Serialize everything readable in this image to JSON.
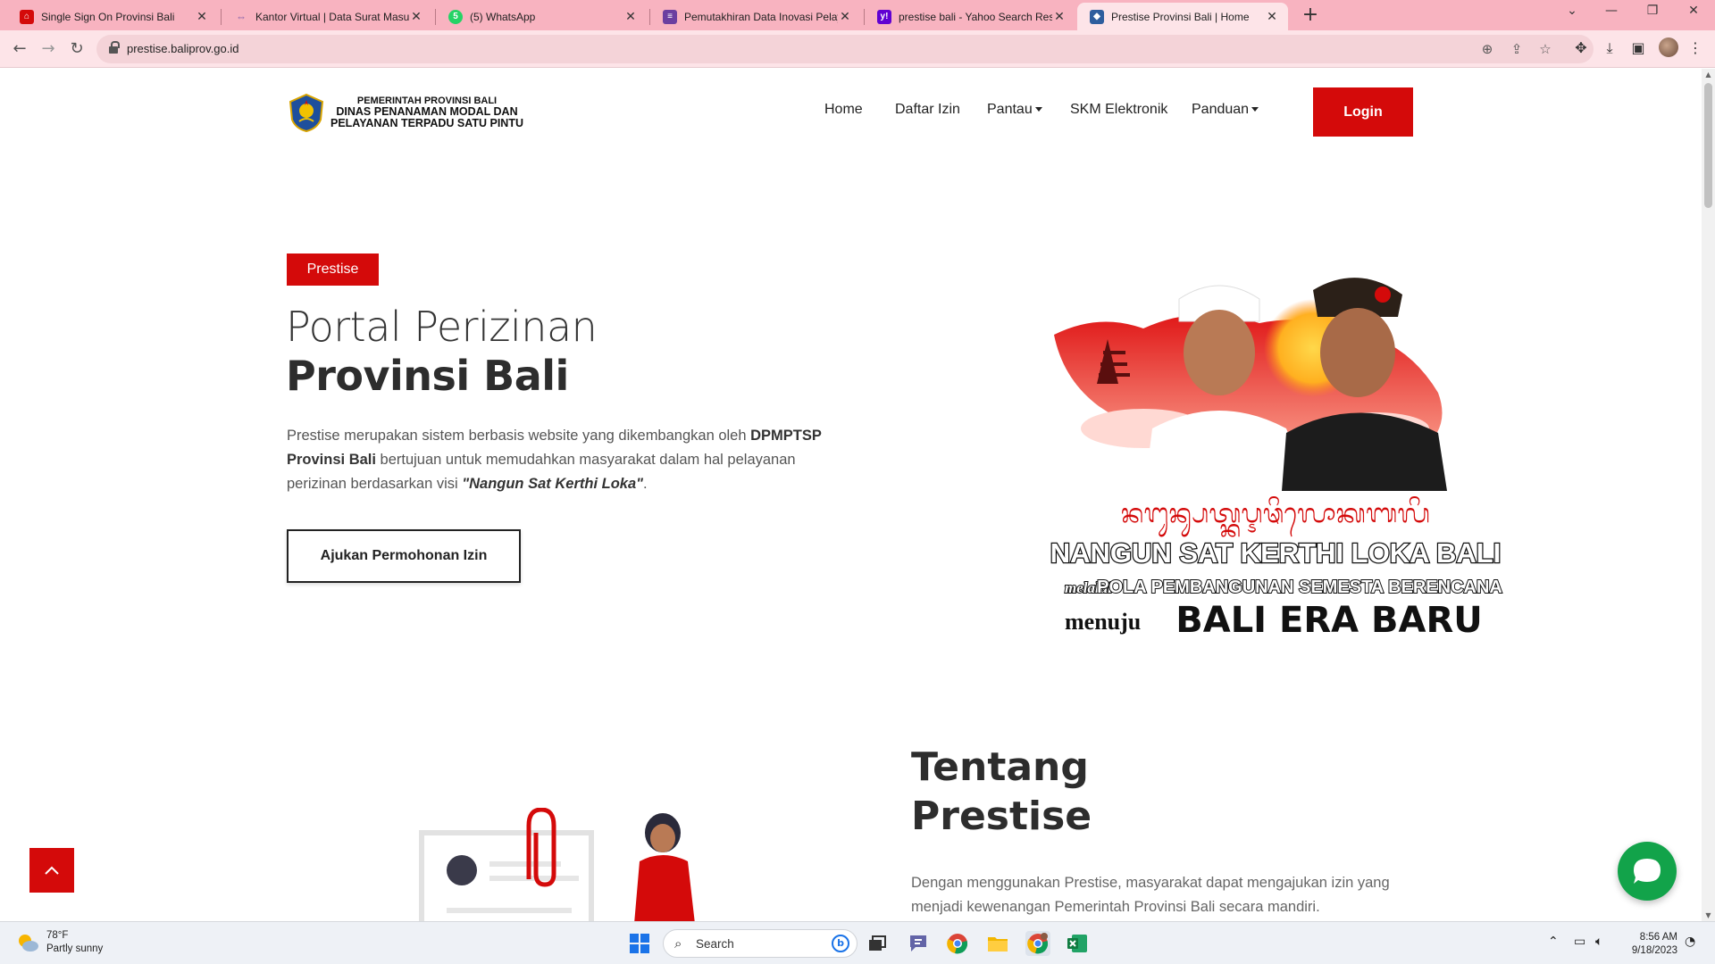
{
  "browser": {
    "tabs": [
      {
        "title": "Single Sign On Provinsi Bali",
        "active": false
      },
      {
        "title": "Kantor Virtual | Data Surat Masuk",
        "active": false
      },
      {
        "title": "(5) WhatsApp",
        "active": false
      },
      {
        "title": "Pemutakhiran Data Inovasi Pelaya",
        "active": false
      },
      {
        "title": "prestise bali - Yahoo Search Resu",
        "active": false
      },
      {
        "title": "Prestise Provinsi Bali | Home",
        "active": true
      }
    ],
    "url": "prestise.baliprov.go.id",
    "accent": "#f8b3c0"
  },
  "site": {
    "logo": {
      "line1": "PEMERINTAH PROVINSI BALI",
      "line2": "DINAS PENANAMAN MODAL DAN",
      "line3": "PELAYANAN TERPADU SATU PINTU"
    },
    "nav": {
      "home": "Home",
      "daftar_izin": "Daftar Izin",
      "pantau": "Pantau",
      "skm": "SKM Elektronik",
      "panduan": "Panduan",
      "login": "Login"
    },
    "brand_color": "#d40a0a"
  },
  "hero": {
    "badge": "Prestise",
    "title_line1": "Portal Perizinan",
    "title_line2": "Provinsi Bali",
    "desc_part1": "Prestise merupakan sistem berbasis website yang dikembangkan oleh ",
    "desc_bold": "DPMPTSP Provinsi Bali",
    "desc_part2": " bertujuan untuk memudahkan masyarakat dalam hal pelayanan perizinan berdasarkan visi ",
    "desc_em": "\"Nangun Sat Kerthi Loka\"",
    "desc_end": ".",
    "cta": "Ajukan Permohonan Izin"
  },
  "banner": {
    "script_text": "ᬦᬗᬸᬦ᭄ᬲᬢ᭄ᬓᬋᬣᬶᬮᭀᬓᬩᬮᬶ",
    "line1": "NANGUN SAT KERTHI LOKA BALI",
    "line2_prefix": "melalui",
    "line2": "POLA PEMBANGUNAN SEMESTA BERENCANA",
    "line3_prefix": "menuju",
    "line3": "BALI ERA BARU"
  },
  "about": {
    "title_line1": "Tentang",
    "title_line2": "Prestise",
    "desc": "Dengan menggunakan Prestise, masyarakat dapat mengajukan izin yang menjadi kewenangan Pemerintah Provinsi Bali secara mandiri."
  },
  "taskbar": {
    "weather_temp": "78°F",
    "weather_desc": "Partly sunny",
    "search": "Search",
    "time": "8:56 AM",
    "date": "9/18/2023"
  }
}
